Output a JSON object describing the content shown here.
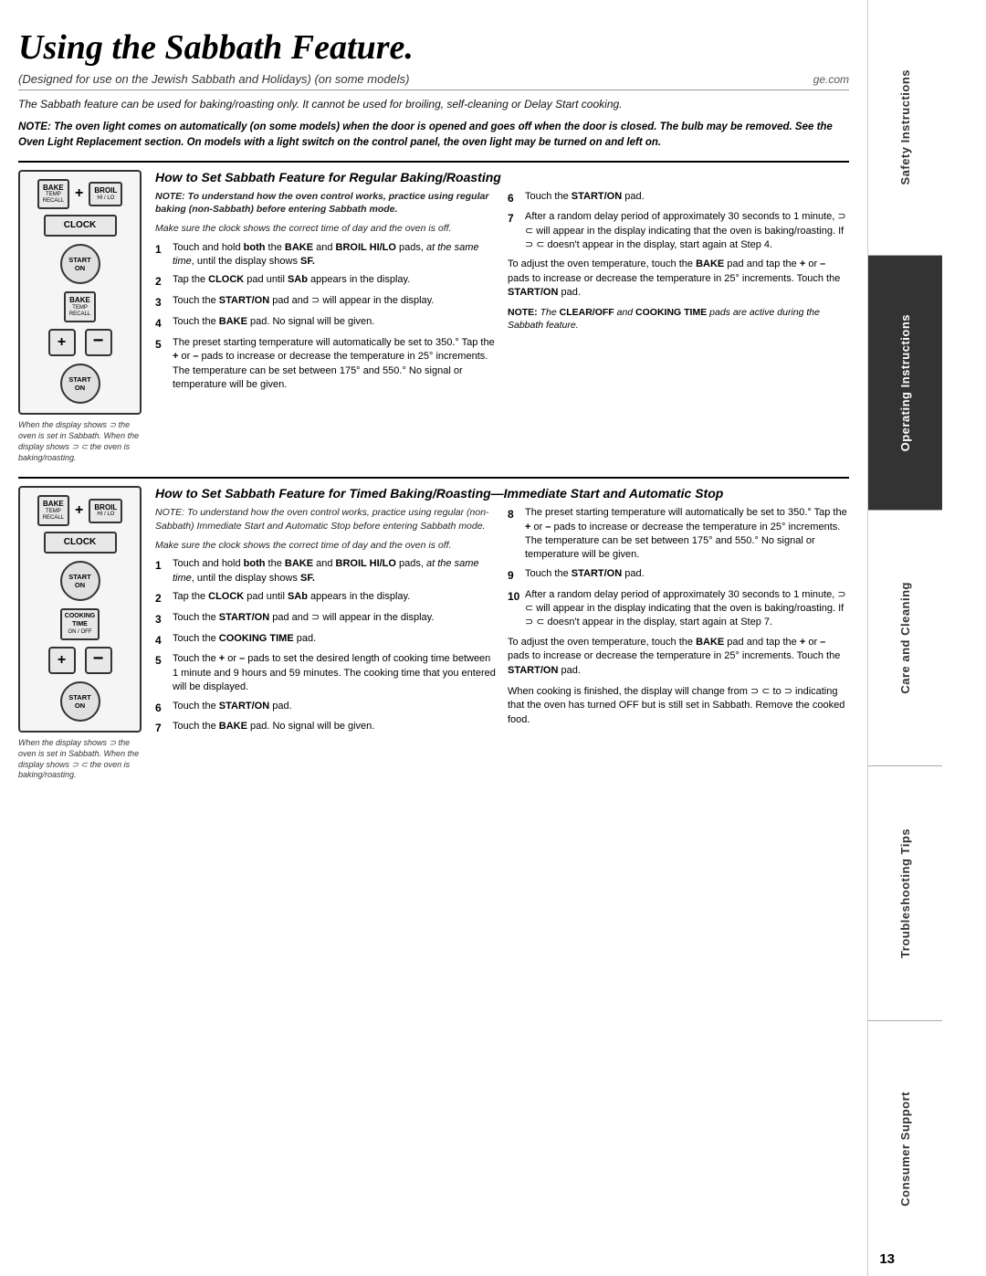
{
  "page": {
    "title": "Using the Sabbath Feature.",
    "subtitle": "(Designed for use on the Jewish Sabbath and Holidays) (on some models)",
    "ge_com": "ge.com",
    "intro_italic": "The Sabbath feature can be used for baking/roasting only. It cannot be used for broiling, self-cleaning or Delay Start cooking.",
    "note_bold": "NOTE: The oven light comes on automatically (on some models) when the door is opened and goes off when the door is closed. The bulb may be removed. See the Oven Light Replacement section. On models with a light switch on the control panel, the oven light may be turned on and left on.",
    "page_number": "13"
  },
  "section1": {
    "title": "How to Set Sabbath Feature for Regular Baking/Roasting",
    "diagram_caption": "When the display shows ⊃ the oven is set in Sabbath. When the display shows ⊃ ⊂ the oven is baking/roasting.",
    "note_intro": "NOTE: To understand how the oven control works, practice using regular baking (non-Sabbath) before entering Sabbath mode.",
    "note_clock": "Make sure the clock shows the correct time of day and the oven is off.",
    "steps_left": [
      {
        "num": "1",
        "text": "Touch and hold both the BAKE and BROIL HI/LO pads, at the same time, until the display shows SF."
      },
      {
        "num": "2",
        "text": "Tap the CLOCK pad until SAb appears in the display."
      },
      {
        "num": "3",
        "text": "Touch the START/ON pad and ⊃ will appear in the display."
      },
      {
        "num": "4",
        "text": "Touch the BAKE pad. No signal will be given."
      },
      {
        "num": "5",
        "text": "The preset starting temperature will automatically be set to 350.° Tap the + or – pads to increase or decrease the temperature in 25° increments. The temperature can be set between 175° and 550.° No signal or temperature will be given."
      }
    ],
    "steps_right": [
      {
        "num": "6",
        "text": "Touch the START/ON pad."
      },
      {
        "num": "7",
        "text": "After a random delay period of approximately 30 seconds to 1 minute, ⊃ ⊂ will appear in the display indicating that the oven is baking/roasting. If ⊃ ⊂ doesn't appear in the display, start again at Step 4."
      }
    ],
    "adjust_text": "To adjust the oven temperature, touch the BAKE pad and tap the + or – pads to increase or decrease the temperature in 25° increments. Touch the START/ON pad.",
    "note_bottom": "NOTE: The CLEAR/OFF and COOKING TIME pads are active during the Sabbath feature."
  },
  "section2": {
    "title": "How to Set Sabbath Feature for Timed Baking/Roasting—Immediate Start and Automatic Stop",
    "diagram_caption": "When the display shows ⊃ the oven is set in Sabbath. When the display shows ⊃ ⊂ the oven is baking/roasting.",
    "note_intro": "NOTE: To understand how the oven control works, practice using regular (non-Sabbath) Immediate Start and Automatic Stop before entering Sabbath mode.",
    "note_clock": "Make sure the clock shows the correct time of day and the oven is off.",
    "steps_left": [
      {
        "num": "1",
        "text": "Touch and hold both the BAKE and BROIL HI/LO pads, at the same time, until the display shows SF."
      },
      {
        "num": "2",
        "text": "Tap the CLOCK pad until SAb appears in the display."
      },
      {
        "num": "3",
        "text": "Touch the START/ON pad and ⊃ will appear in the display."
      },
      {
        "num": "4",
        "text": "Touch the COOKING TIME pad."
      },
      {
        "num": "5",
        "text": "Touch the + or – pads to set the desired length of cooking time between 1 minute and 9 hours and 59 minutes. The cooking time that you entered will be displayed."
      },
      {
        "num": "6",
        "text": "Touch the START/ON pad."
      },
      {
        "num": "7",
        "text": "Touch the BAKE pad. No signal will be given."
      }
    ],
    "steps_right": [
      {
        "num": "8",
        "text": "The preset starting temperature will automatically be set to 350.° Tap the + or – pads to increase or decrease the temperature in 25° increments. The temperature can be set between 175° and 550.° No signal or temperature will be given."
      },
      {
        "num": "9",
        "text": "Touch the START/ON pad."
      },
      {
        "num": "10",
        "text": "After a random delay period of approximately 30 seconds to 1 minute, ⊃ ⊂ will appear in the display indicating that the oven is baking/roasting. If ⊃ ⊂ doesn't appear in the display, start again at Step 7."
      }
    ],
    "adjust_text": "To adjust the oven temperature, touch the BAKE pad and tap the + or – pads to increase or decrease the temperature in 25° increments. Touch the START/ON pad.",
    "finish_text": "When cooking is finished, the display will change from ⊃ ⊂ to ⊃ indicating that the oven has turned OFF but is still set in Sabbath. Remove the cooked food."
  },
  "sidebar": {
    "sections": [
      "Safety Instructions",
      "Operating Instructions",
      "Care and Cleaning",
      "Troubleshooting Tips",
      "Consumer Support"
    ]
  },
  "diagram1": {
    "bake_label": "BAKE",
    "bake_sub": "TEMP\nRECALL",
    "broil_label": "BROIL",
    "broil_sub": "HI / LO",
    "plus_label": "+",
    "clock_label": "CLOCK",
    "start_label": "START\nON",
    "bake2_label": "BAKE",
    "bake2_sub": "TEMP\nRECALL",
    "minus_label": "–"
  },
  "diagram2": {
    "bake_label": "BAKE",
    "bake_sub": "TEMP\nRECALL",
    "broil_label": "BROIL",
    "broil_sub": "HI / LO",
    "plus_label": "+",
    "clock_label": "CLOCK",
    "start_label": "START\nON",
    "cooking_time_label": "COOKING\nTIME",
    "cooking_time_sub": "ON / OFF",
    "minus_label": "–"
  }
}
